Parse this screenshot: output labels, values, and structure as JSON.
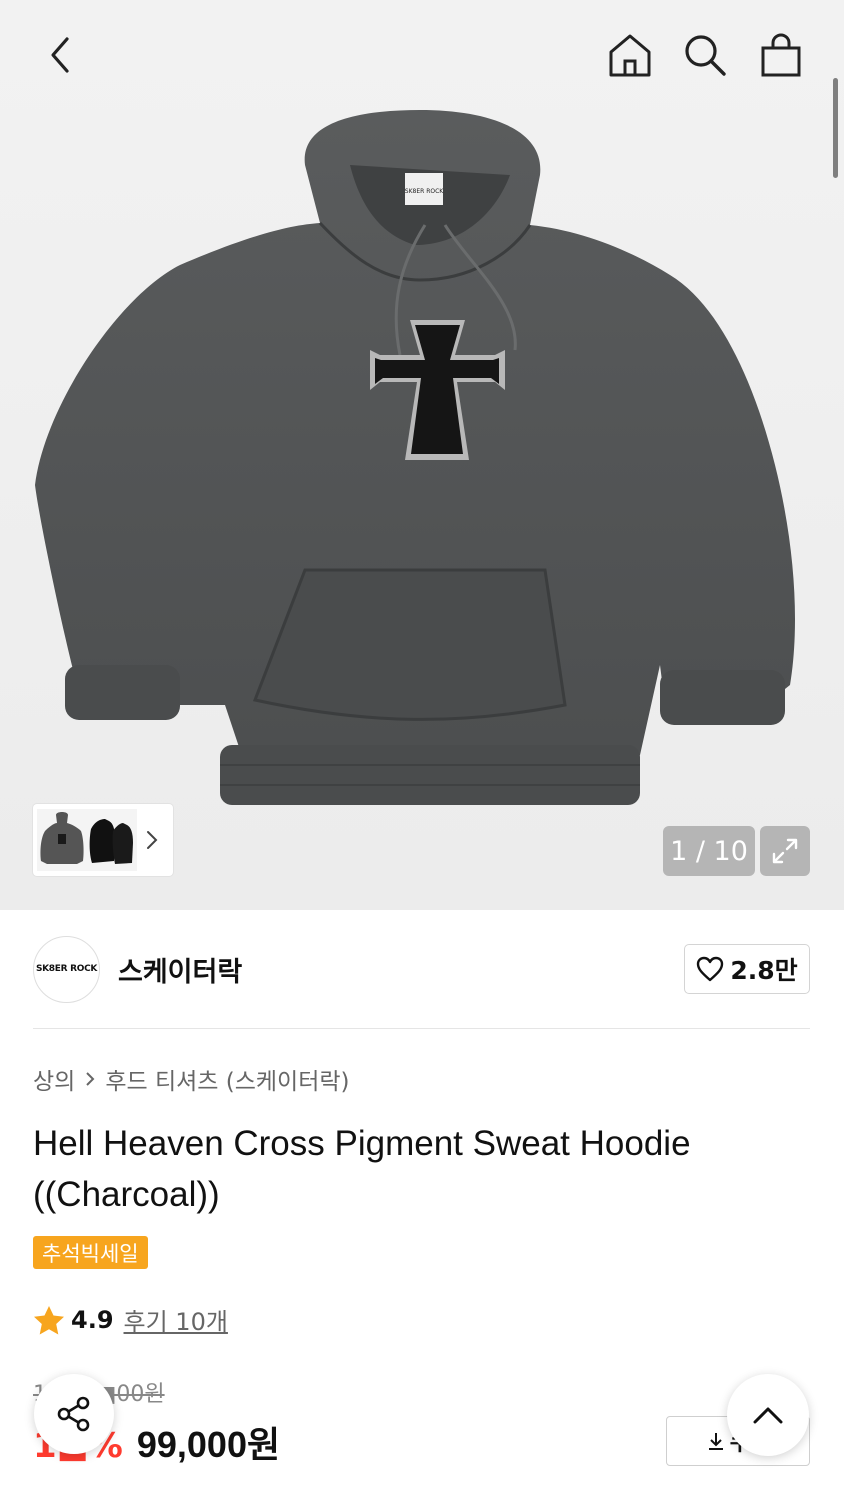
{
  "header": {
    "back_icon": "chevron-left-icon",
    "home_icon": "home-icon",
    "search_icon": "search-icon",
    "cart_icon": "shopping-bag-icon"
  },
  "gallery": {
    "counter": "1 / 10",
    "expand_icon": "expand-icon",
    "thumb_chevron_icon": "chevron-right-icon",
    "print_text": "SK8ER ROCK"
  },
  "brand": {
    "logo_text": "SK8ER ROCK",
    "name": "스케이터락",
    "likes": "2.8만"
  },
  "breadcrumb": {
    "category": "상의",
    "subcategory": "후드 티셔츠 (스케이터락)"
  },
  "product": {
    "title": "Hell Heaven Cross Pigment Sweat Hoodie ((Charcoal))",
    "badge": "추석빅세일"
  },
  "rating": {
    "score": "4.9",
    "reviews": "후기 10개"
  },
  "price": {
    "original": "1■■,■00원",
    "discount": "1■%",
    "sale": "99,000원"
  },
  "coupon": {
    "label": "쿠폰"
  },
  "colors": {
    "badge": "#f7a51e",
    "discount": "#ff3b2f",
    "counter_bg": "#b5b5b5"
  }
}
